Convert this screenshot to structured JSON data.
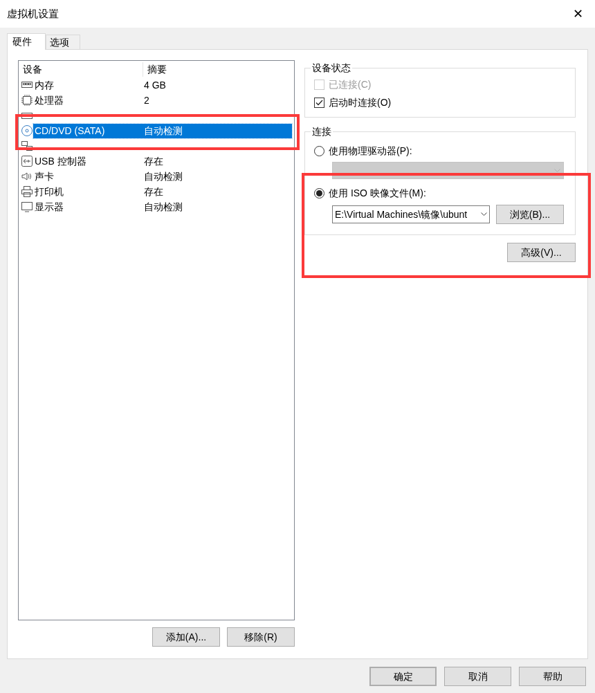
{
  "window": {
    "title": "虚拟机设置",
    "close": "✕"
  },
  "tabs": [
    {
      "label": "硬件",
      "selected": true
    },
    {
      "label": "选项",
      "selected": false
    }
  ],
  "device_list": {
    "columns": [
      "设备",
      "摘要"
    ],
    "rows": [
      {
        "kind": "memory",
        "device": "内存",
        "summary": "4 GB",
        "selected": false
      },
      {
        "kind": "cpu",
        "device": "处理器",
        "summary": "2",
        "selected": false
      },
      {
        "kind": "disk"
      },
      {
        "kind": "cd",
        "device": "CD/DVD (SATA)",
        "summary": "自动检测",
        "selected": true
      },
      {
        "kind": "network"
      },
      {
        "kind": "usb",
        "device": "USB 控制器",
        "summary": "存在",
        "selected": false
      },
      {
        "kind": "sound",
        "device": "声卡",
        "summary": "自动检测",
        "selected": false
      },
      {
        "kind": "printer",
        "device": "打印机",
        "summary": "存在",
        "selected": false
      },
      {
        "kind": "display",
        "device": "显示器",
        "summary": "自动检测",
        "selected": false
      }
    ],
    "buttons": [
      "添加(A)...",
      "移除(R)"
    ]
  },
  "device_status": {
    "title": "设备状态",
    "options": [
      {
        "label": "已连接(C)",
        "checked": false,
        "disabled": true
      },
      {
        "label": "启动时连接(O)",
        "checked": true,
        "disabled": false
      }
    ]
  },
  "connection": {
    "title": "连接",
    "physical": {
      "label": "使用物理驱动器(P):",
      "selected": false
    },
    "iso": {
      "label": "使用 ISO 映像文件(M):",
      "selected": true,
      "path": "E:\\Virtual Machines\\镜像\\ubunt",
      "browse": "浏览(B)..."
    }
  },
  "advanced": "高级(V)...",
  "footer": [
    "确定",
    "取消",
    "帮助"
  ]
}
